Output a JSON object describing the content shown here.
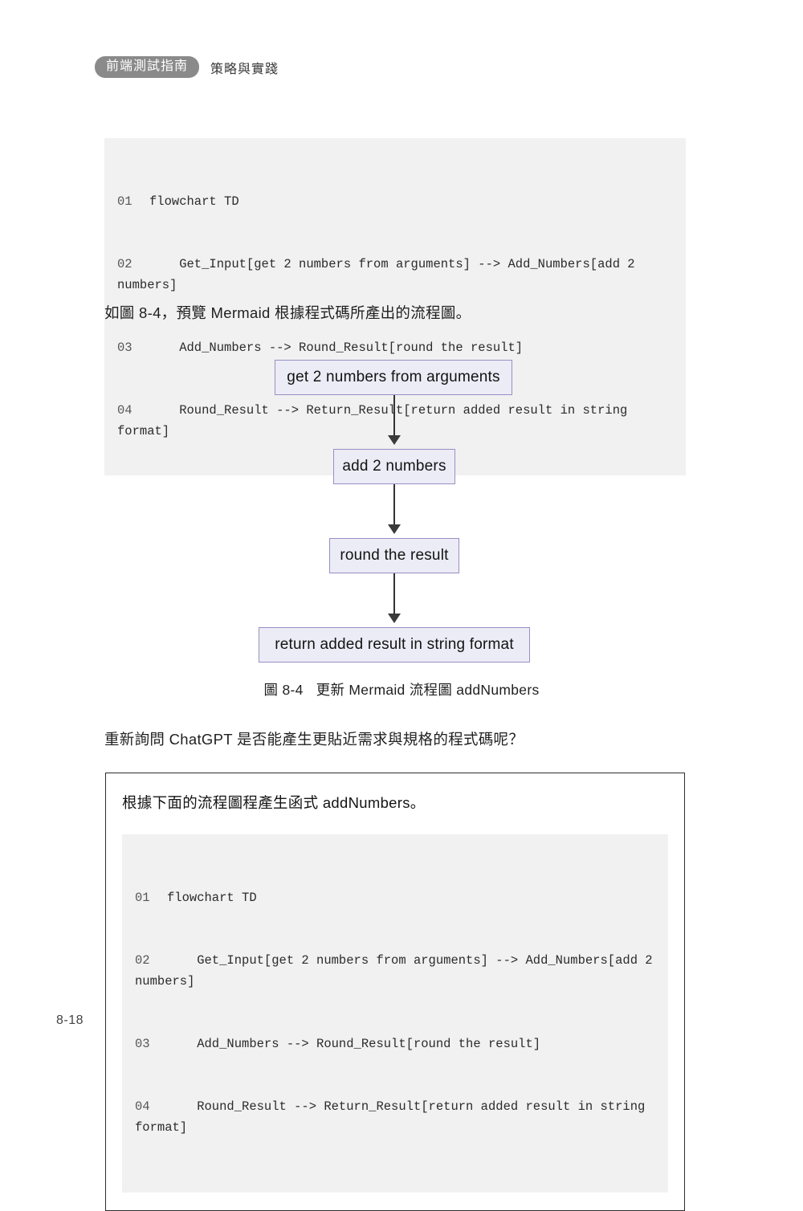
{
  "header": {
    "badge": "前端測試指南",
    "subtitle": "策略與實踐"
  },
  "code_block_1": {
    "lines": [
      {
        "no": "01",
        "text": "flowchart TD"
      },
      {
        "no": "02",
        "text": "    Get_Input[get 2 numbers from arguments] --> Add_Numbers[add 2 numbers]"
      },
      {
        "no": "03",
        "text": "    Add_Numbers --> Round_Result[round the result]"
      },
      {
        "no": "04",
        "text": "    Round_Result --> Return_Result[return added result in string format]"
      }
    ]
  },
  "paragraphs": {
    "preview": "如圖 8-4，預覽 Mermaid 根據程式碼所產出的流程圖。",
    "reask": "重新詢問 ChatGPT 是否能產生更貼近需求與規格的程式碼呢？"
  },
  "flowchart": {
    "nodes": [
      {
        "id": "Get_Input",
        "label": "get 2 numbers from arguments"
      },
      {
        "id": "Add_Numbers",
        "label": "add 2 numbers"
      },
      {
        "id": "Round_Result",
        "label": "round the result"
      },
      {
        "id": "Return_Result",
        "label": "return added result in string format"
      }
    ],
    "edges": [
      {
        "from": "Get_Input",
        "to": "Add_Numbers"
      },
      {
        "from": "Add_Numbers",
        "to": "Round_Result"
      },
      {
        "from": "Round_Result",
        "to": "Return_Result"
      }
    ],
    "node_fill": "#ececf6",
    "node_border": "#9a8ec4",
    "edge_color": "#333333"
  },
  "figure_caption": {
    "number": "圖 8-4",
    "title": "更新 Mermaid 流程圖 addNumbers"
  },
  "prompt_box": {
    "question": "根據下面的流程圖程產生函式 addNumbers。",
    "code_lines": [
      {
        "no": "01",
        "text": "flowchart TD"
      },
      {
        "no": "02",
        "text": "    Get_Input[get 2 numbers from arguments] --> Add_Numbers[add 2 numbers]"
      },
      {
        "no": "03",
        "text": "    Add_Numbers --> Round_Result[round the result]"
      },
      {
        "no": "04",
        "text": "    Round_Result --> Return_Result[return added result in string format]"
      }
    ]
  },
  "page_number": "8-18"
}
